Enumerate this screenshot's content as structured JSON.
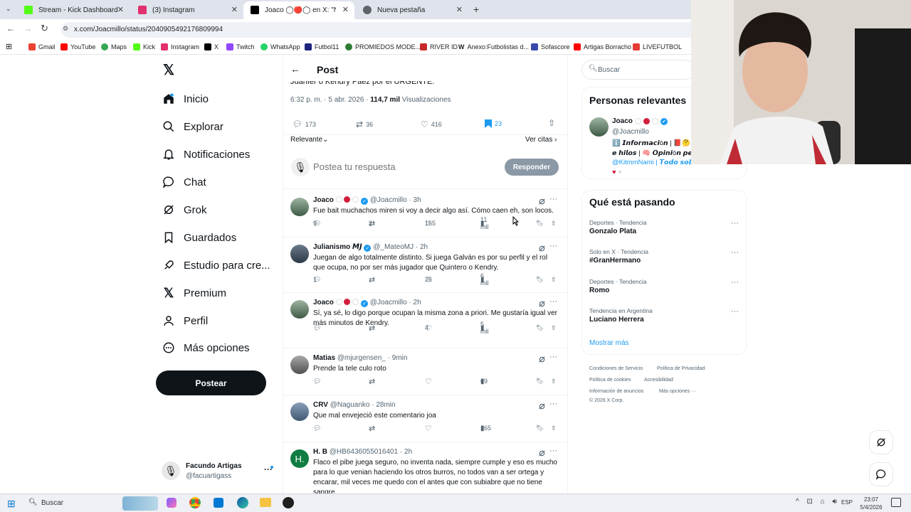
{
  "browser": {
    "tabs": [
      {
        "title": "Stream - Kick Dashboard",
        "color": "#53fc18"
      },
      {
        "title": "(3) Instagram",
        "color": "#e1306c"
      },
      {
        "title": "Joaco ◯🔴◯ en X: \"No sé qu",
        "color": "#000000"
      },
      {
        "title": "Nueva pestaña",
        "color": "#5f6368"
      }
    ],
    "url": "x.com/Joacmillo/status/2040905492176809994",
    "bookmarks": [
      "Gmail",
      "YouTube",
      "Maps",
      "Kick",
      "Instagram",
      "X",
      "Twitch",
      "WhatsApp",
      "Futbol11",
      "PROMIEDOS MODE...",
      "RIVER ID",
      "Anexo:Futbolistas d...",
      "Sofascore",
      "Artigas Borracho",
      "LIVEFUTBOL"
    ]
  },
  "nav": {
    "items": [
      "Inicio",
      "Explorar",
      "Notificaciones",
      "Chat",
      "Grok",
      "Guardados",
      "Estudio para cre...",
      "Premium",
      "Perfil",
      "Más opciones"
    ],
    "post_button": "Postear",
    "user_name": "Facundo Artigas",
    "user_handle": "@facuartigass"
  },
  "main": {
    "header": "Post",
    "cut_text": "Juanfer o Kendry Páez por el URGENTE.",
    "meta_time": "6:32 p. m. · 5 abr. 2026 · ",
    "meta_views": "114,7 mil",
    "meta_views_label": " Visualizaciones",
    "stats": {
      "replies": "173",
      "reposts": "36",
      "likes": "416",
      "bookmarks": "23"
    },
    "sort_label": "Relevante",
    "quotes_label": "Ver citas",
    "reply_placeholder": "Postea tu respuesta",
    "reply_button": "Responder",
    "replies": [
      {
        "name": "Joaco",
        "handle": "@Joacmillo · 3h",
        "text": "Fue bait muchachos miren si voy a decir algo así. Cómo caen eh, son locos.",
        "c": "9",
        "r": "2",
        "l": "165",
        "v": "11 mil"
      },
      {
        "name": "Julianismo 𝙈𝙅",
        "handle": "@_MateoMJ · 2h",
        "text": "Juegan de algo totalmente distinto. Si juega Galván es por su perfil y el rol que ocupa, no por ser más jugador que Quintero o Kendry.",
        "c": "1",
        "r": "",
        "l": "26",
        "v": "6 mil"
      },
      {
        "name": "Joaco",
        "handle": "@Joacmillo · 2h",
        "text": "Sí, ya sé, lo digo porque ocupan la misma zona a priori. Me gustaría igual ver más minutos de Kendry.",
        "c": "",
        "r": "",
        "l": "4",
        "v": "5 mil"
      },
      {
        "name": "Matias",
        "handle": "@mjurgensen_ · 9min",
        "text": "Prende la tele culo roto",
        "c": "",
        "r": "",
        "l": "",
        "v": "69"
      },
      {
        "name": "CRV",
        "handle": "@Naguanko · 28min",
        "text": "Que mal envejeció este comentario joa",
        "c": "",
        "r": "",
        "l": "",
        "v": "165"
      },
      {
        "name": "H. B",
        "handle": "@HB6436055016401 · 2h",
        "text": "Flaco el pibe juega seguro, no inventa nada, siempre cumple y eso es mucho para lo que venian haciendo los otros burros, no todos van a ser ortega y encarar, mil veces me quedo con el antes que con subiabre que no tiene sangre",
        "c": "",
        "r": "",
        "l": "",
        "v": ""
      }
    ]
  },
  "right": {
    "search_placeholder": "Buscar",
    "people_title": "Personas relevantes",
    "person_name": "Joaco",
    "person_handle": "@Joacmillo",
    "bio_line1": "ℹ️ 𝙄𝙣𝙛𝙤𝙧𝙢𝙖𝙘𝙞ó𝙣 | 📕🤔",
    "bio_line2": "𝙚 𝙝𝙞𝙡𝙤𝙨 | 🧠 𝙊𝙥𝙞𝙣𝙞ó𝙣 𝙥𝙚𝙧",
    "bio_line3": "@KitmmNami | 𝙏𝙤𝙙𝙤 𝙨𝙤𝙗",
    "trends_title": "Qué está pasando",
    "trends": [
      {
        "cat": "Deportes · Tendencia",
        "name": "Gonzalo Plata"
      },
      {
        "cat": "Solo en X · Tendencia",
        "name": "#GranHermano"
      },
      {
        "cat": "Deportes · Tendencia",
        "name": "Romo"
      },
      {
        "cat": "Tendencia en Argentina",
        "name": "Luciano Herrera"
      }
    ],
    "show_more": "Mostrar más",
    "footer": [
      "Condiciones de Servicio",
      "Política de Privacidad",
      "Política de cookies",
      "Accesibilidad",
      "Información de anuncios",
      "Más opciones ···",
      "© 2026 X Corp."
    ]
  },
  "taskbar": {
    "search": "Buscar",
    "lang": "ESP",
    "time": "23:07",
    "date": "5/4/2026"
  },
  "colors": {
    "accent": "#1d9bf0",
    "text": "#0f1419",
    "muted": "#536471"
  }
}
